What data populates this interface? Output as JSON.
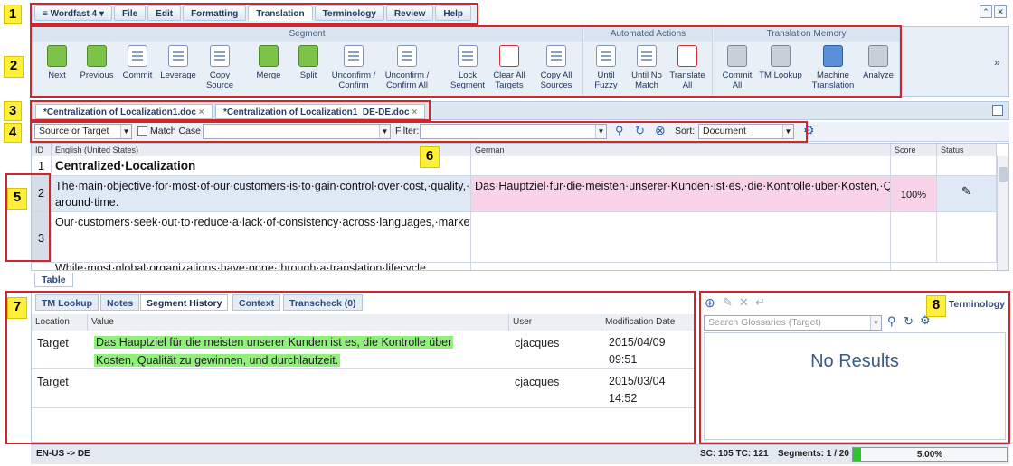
{
  "callouts": [
    "1",
    "2",
    "3",
    "4",
    "5",
    "6",
    "7",
    "8"
  ],
  "menu": {
    "items": [
      "Wordfast 4",
      "File",
      "Edit",
      "Formatting",
      "Translation",
      "Terminology",
      "Review",
      "Help"
    ],
    "active": "Translation"
  },
  "window_controls": {
    "restore": "⌃",
    "close": "✕"
  },
  "ribbon": {
    "groups": {
      "segment": "Segment",
      "automated": "Automated Actions",
      "tm": "Translation Memory"
    },
    "buttons": {
      "next": "Next",
      "previous": "Previous",
      "commit": "Commit",
      "leverage": "Leverage",
      "copy_source": "Copy Source",
      "merge": "Merge",
      "split": "Split",
      "unconfirm_confirm": "Unconfirm / Confirm",
      "unconfirm_confirm_all": "Unconfirm / Confirm All",
      "lock_segment": "Lock Segment",
      "clear_all_targets": "Clear All Targets",
      "copy_all_sources": "Copy All Sources",
      "until_fuzzy": "Until Fuzzy",
      "until_no_match": "Until No Match",
      "translate_all": "Translate All",
      "commit_all": "Commit All",
      "tm_lookup": "TM Lookup",
      "machine_translation": "Machine Translation",
      "analyze": "Analyze"
    },
    "more": "»"
  },
  "doc_tabs": [
    "*Centralization of Localization1.doc",
    "*Centralization of Localization1_DE-DE.doc"
  ],
  "filter": {
    "scope": "Source or Target",
    "match_case": "Match Case",
    "filter_label": "Filter:",
    "sort_label": "Sort:",
    "sort_value": "Document"
  },
  "grid": {
    "headers": {
      "id": "ID",
      "source": "English (United States)",
      "target": "German",
      "score": "Score",
      "status": "Status"
    },
    "rows": [
      {
        "id": "1",
        "source": "Centralized·Localization",
        "target": "",
        "score": "",
        "status": ""
      },
      {
        "id": "2",
        "source": "The·main·objective·for·most·of·our·customers·is·to·gain·control·over·cost,·quality,·and·turn-around·time.",
        "target": "Das·Hauptziel·für·die·meisten·unserer·Kunden·ist·es,·die·Kontrolle·über·Kosten,·Qualität·zu·gewinnen,·und·durchlaufzeit.·",
        "score": "100%",
        "status": "edit"
      },
      {
        "id": "3",
        "source": "Our·customers·seek·out·to·reduce·a·lack·of·consistency·across·languages,·markets·and·programs,·a·lack·of·cost·control·over·the·same,·and·significant·delays·in·launching·global·initiatives.",
        "target": "",
        "score": "",
        "status": ""
      },
      {
        "id": "",
        "source": "While·most·global·organizations·have·gone·through·a·translation·lifecycle",
        "target": "",
        "score": "",
        "status": ""
      }
    ],
    "table_tab": "Table"
  },
  "bottom": {
    "tabs": [
      "TM Lookup",
      "Notes",
      "Segment History",
      "Context",
      "Transcheck (0)"
    ],
    "active_tab": "Segment History",
    "headers": {
      "location": "Location",
      "value": "Value",
      "user": "User",
      "date": "Modification Date"
    },
    "rows": [
      {
        "location": "Target",
        "value": "Das Hauptziel für die meisten unserer Kunden ist es, die Kontrolle über Kosten, Qualität zu gewinnen, und durchlaufzeit.",
        "user": "cjacques",
        "date": "2015/04/09 09:51"
      },
      {
        "location": "Target",
        "value": "",
        "user": "cjacques",
        "date": "2015/03/04 14:52"
      }
    ]
  },
  "terminology": {
    "title": "Terminology",
    "search_placeholder": "Search Glossaries (Target)",
    "no_results": "No Results"
  },
  "status": {
    "lang_pair": "EN-US -> DE",
    "counts": "SC: 105 TC: 121",
    "segments": "Segments: 1 / 20",
    "progress_label": "5.00%",
    "progress": 0.05
  },
  "colors": {
    "callout": "#ffef3a",
    "highlight_red": "#d0262e",
    "target_pink": "#f9d4e8",
    "history_green": "#8ff07a",
    "progress_green": "#2fc42f",
    "no_results": "#3a5b8c"
  }
}
